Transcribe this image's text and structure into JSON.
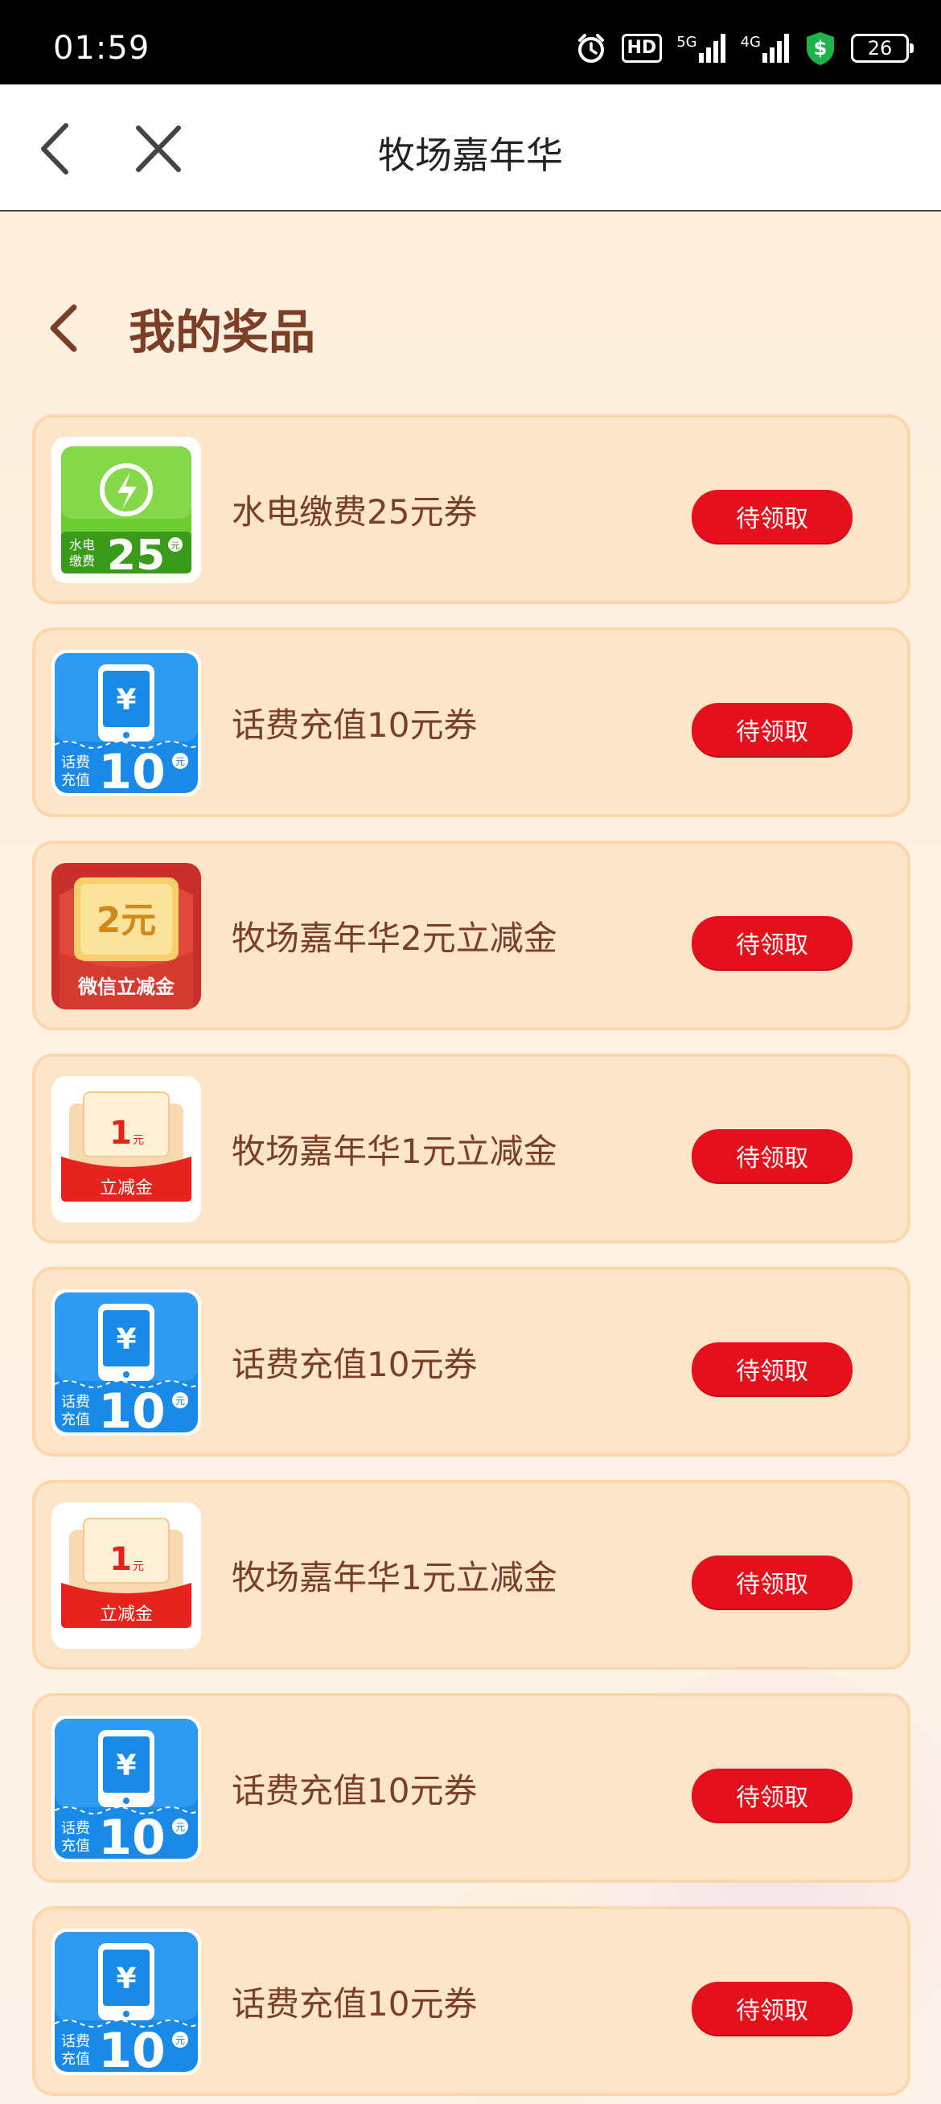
{
  "status_bar": {
    "time": "01:59",
    "hd_label": "HD",
    "net_5g": "5G",
    "net_4g": "4G",
    "battery": "26"
  },
  "title_bar": {
    "title": "牧场嘉年华"
  },
  "page": {
    "heading": "我的奖品"
  },
  "prizes": [
    {
      "name": "水电缴费25元券",
      "button": "待领取",
      "thumb": "utility-25",
      "thumb_label_top": "水电",
      "thumb_label_bottom": "缴费",
      "thumb_value": "25",
      "thumb_unit": "元"
    },
    {
      "name": "话费充值10元券",
      "button": "待领取",
      "thumb": "phone-10",
      "thumb_label_top": "话费",
      "thumb_label_bottom": "充值",
      "thumb_value": "10",
      "thumb_unit": "元"
    },
    {
      "name": "牧场嘉年华2元立减金",
      "button": "待领取",
      "thumb": "wechat-2",
      "thumb_value": "2元",
      "thumb_caption": "微信立减金"
    },
    {
      "name": "牧场嘉年华1元立减金",
      "button": "待领取",
      "thumb": "red-1",
      "thumb_value": "1",
      "thumb_unit": "元",
      "thumb_caption": "立减金"
    },
    {
      "name": "话费充值10元券",
      "button": "待领取",
      "thumb": "phone-10",
      "thumb_label_top": "话费",
      "thumb_label_bottom": "充值",
      "thumb_value": "10",
      "thumb_unit": "元"
    },
    {
      "name": "牧场嘉年华1元立减金",
      "button": "待领取",
      "thumb": "red-1",
      "thumb_value": "1",
      "thumb_unit": "元",
      "thumb_caption": "立减金"
    },
    {
      "name": "话费充值10元券",
      "button": "待领取",
      "thumb": "phone-10",
      "thumb_label_top": "话费",
      "thumb_label_bottom": "充值",
      "thumb_value": "10",
      "thumb_unit": "元"
    },
    {
      "name": "话费充值10元券",
      "button": "待领取",
      "thumb": "phone-10",
      "thumb_label_top": "话费",
      "thumb_label_bottom": "充值",
      "thumb_value": "10",
      "thumb_unit": "元"
    }
  ],
  "colors": {
    "brand_text": "#7a3f26",
    "button_red": "#e6101c",
    "card_bg": "#fde5c9",
    "card_border": "#fcd7ad",
    "phone_blue": "#1a8ae8",
    "utility_green": "#5cc02c"
  }
}
